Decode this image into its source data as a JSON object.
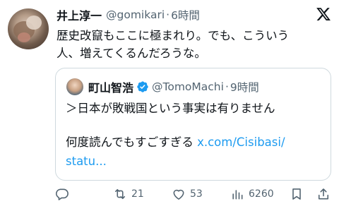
{
  "tweet": {
    "display_name": "井上淳一",
    "handle": "@gomikari",
    "separator": "·",
    "time": "6時間",
    "text_lines": [
      "歴史改竄もここに極まれり。でも、こういう",
      "人、増えてくるんだろうな。"
    ]
  },
  "quote": {
    "display_name": "町山智浩",
    "handle": "@TomoMachi",
    "separator": "·",
    "time": "9時間",
    "line1": "＞日本が敗戦国という事実は有りません",
    "line2_text": "何度読んでもすごすぎる ",
    "line2_link": "x.com/Cisibasi/",
    "line3_link": "statu..."
  },
  "actions": {
    "reply_count": "",
    "retweet_count": "21",
    "like_count": "53",
    "view_count": "6260"
  },
  "icons": {
    "logo": "x-logo-icon",
    "verified": "verified-badge-icon",
    "reply": "reply-icon",
    "retweet": "retweet-icon",
    "like": "heart-icon",
    "views": "analytics-icon",
    "bookmark": "bookmark-icon",
    "share": "share-icon"
  },
  "colors": {
    "text": "#0f1419",
    "secondary": "#536471",
    "accent": "#1d9bf0",
    "border": "#cfd9de"
  }
}
